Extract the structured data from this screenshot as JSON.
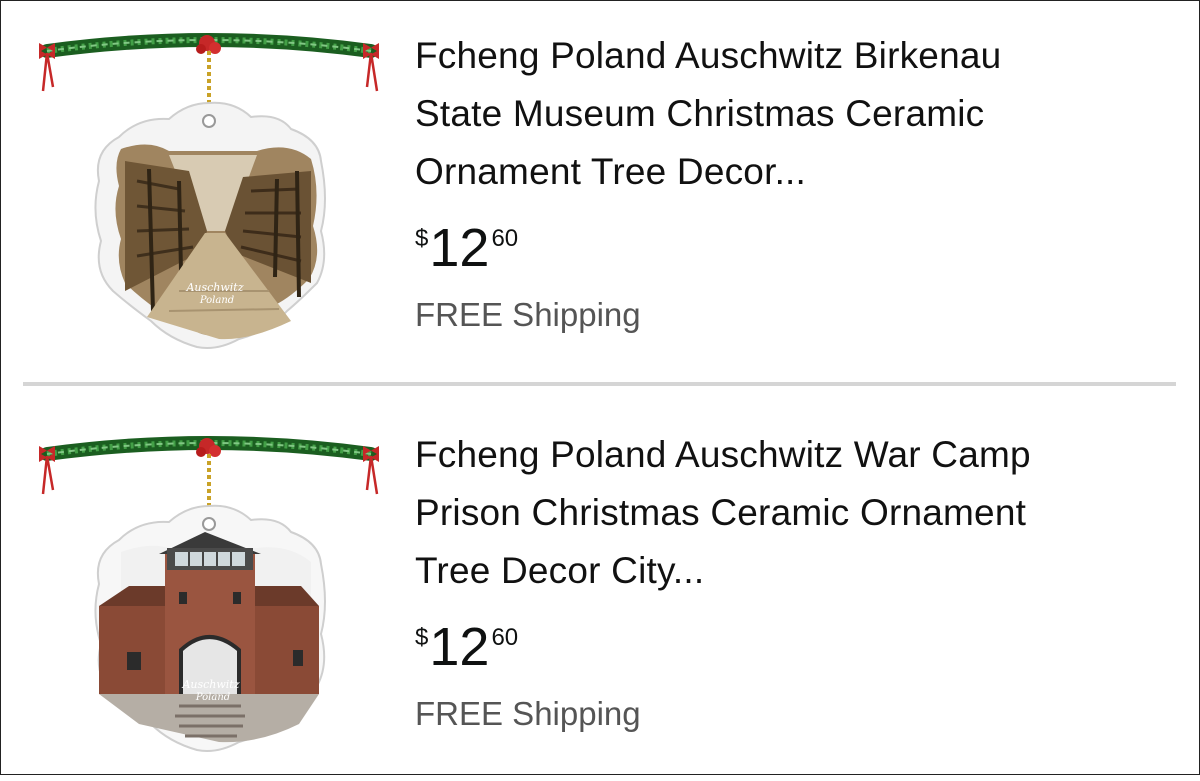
{
  "results": [
    {
      "title": "Fcheng Poland Auschwitz Birkenau State Museum Christmas Ceramic Ornament Tree Decor...",
      "title_lines": [
        "Fcheng Poland Auschwitz Birkenau",
        "State Museum Christmas Ceramic",
        "Ornament Tree Decor..."
      ],
      "price_symbol": "$",
      "price_whole": "12",
      "price_fraction": "60",
      "shipping": "FREE Shipping",
      "ornament_label_1": "Auschwitz",
      "ornament_label_2": "Poland"
    },
    {
      "title": "Fcheng Poland Auschwitz War Camp Prison Christmas Ceramic Ornament Tree Decor City...",
      "title_lines": [
        "Fcheng Poland Auschwitz War Camp",
        "Prison Christmas Ceramic Ornament",
        "Tree Decor City..."
      ],
      "price_symbol": "$",
      "price_whole": "12",
      "price_fraction": "60",
      "shipping": "FREE Shipping",
      "ornament_label_1": "Auschwitz",
      "ornament_label_2": "Poland"
    }
  ],
  "colors": {
    "text": "#111111",
    "shipping": "#555555",
    "divider": "#d5d5d5",
    "garland": "#2e7d32",
    "berry": "#c62828",
    "ribbon": "#b71c1c"
  }
}
